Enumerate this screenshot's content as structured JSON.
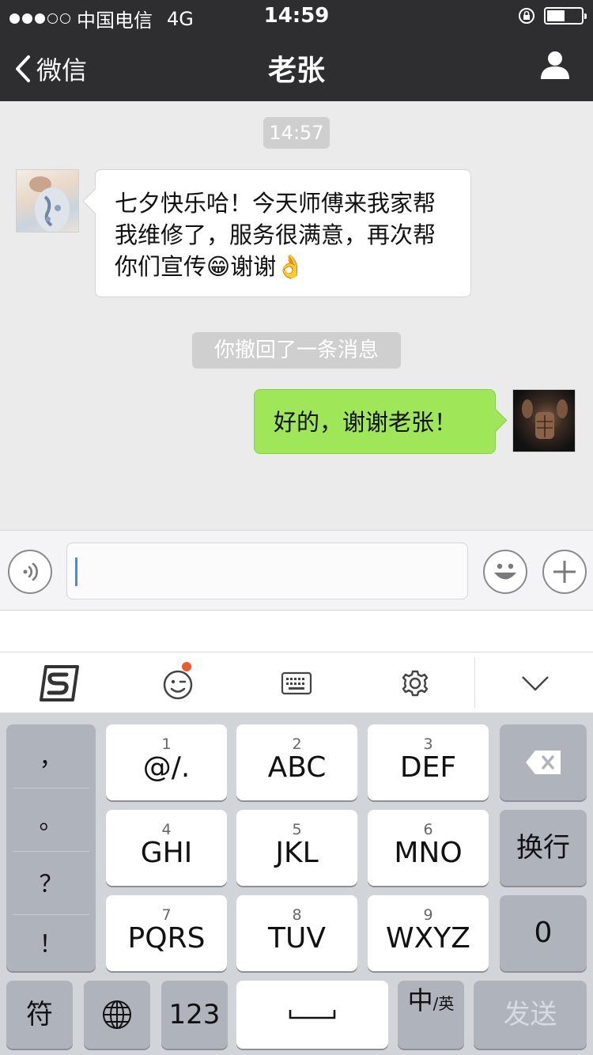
{
  "status_bar": {
    "carrier": "中国电信",
    "network": "4G",
    "time": "14:59"
  },
  "nav": {
    "back_label": "微信",
    "title": "老张"
  },
  "chat": {
    "timestamp": "14:57",
    "messages": [
      {
        "side": "left",
        "text": "七夕快乐哈！今天师傅来我家帮我维修了，服务很满意，再次帮你们宣传😁谢谢👌"
      },
      {
        "side": "right",
        "text": "好的，谢谢老张！"
      }
    ],
    "recalled_notice": "你撤回了一条消息"
  },
  "keyboard": {
    "punctuation": [
      "，",
      "。",
      "？",
      "！"
    ],
    "keys": [
      {
        "sub": "1",
        "main": "@/."
      },
      {
        "sub": "2",
        "main": "ABC"
      },
      {
        "sub": "3",
        "main": "DEF"
      },
      {
        "sub": "4",
        "main": "GHI"
      },
      {
        "sub": "5",
        "main": "JKL"
      },
      {
        "sub": "6",
        "main": "MNO"
      },
      {
        "sub": "7",
        "main": "PQRS"
      },
      {
        "sub": "8",
        "main": "TUV"
      },
      {
        "sub": "9",
        "main": "WXYZ"
      }
    ],
    "newline": "换行",
    "zero": "0",
    "symbol": "符",
    "num": "123",
    "lang_main": "中",
    "lang_sub": "/英",
    "send": "发送"
  },
  "colors": {
    "nav_bg": "#2e2e30",
    "chat_bg": "#ebebeb",
    "bubble_green": "#9fe658",
    "keyboard_bg": "#d1d4d9",
    "key_dark": "#aeb3bc",
    "badge_orange": "#f05a28",
    "caret_blue": "#3b8bff"
  }
}
